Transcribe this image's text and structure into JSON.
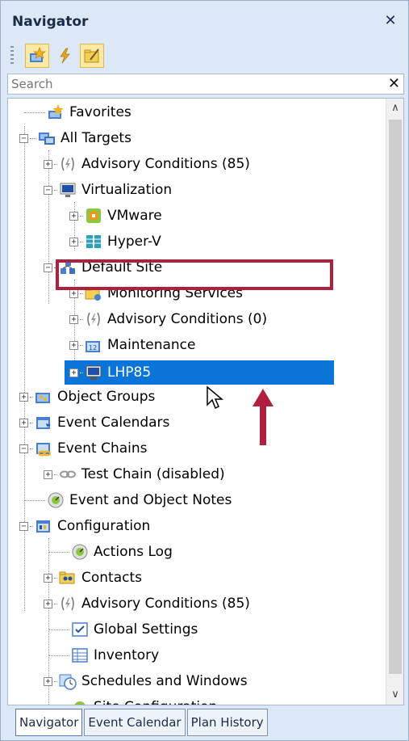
{
  "panel": {
    "title": "Navigator"
  },
  "search": {
    "placeholder": "Search"
  },
  "tree": [
    {
      "label": "Favorites"
    },
    {
      "label": "All Targets"
    },
    {
      "label": "Advisory Conditions (85)"
    },
    {
      "label": "Virtualization"
    },
    {
      "label": "VMware"
    },
    {
      "label": "Hyper-V"
    },
    {
      "label": "Default Site"
    },
    {
      "label": "Monitoring Services"
    },
    {
      "label": "Advisory Conditions (0)"
    },
    {
      "label": "Maintenance"
    },
    {
      "label": "LHP85",
      "selected": true
    },
    {
      "label": "Object Groups"
    },
    {
      "label": "Event Calendars"
    },
    {
      "label": "Event Chains"
    },
    {
      "label": "Test Chain (disabled)"
    },
    {
      "label": "Event and Object Notes"
    },
    {
      "label": "Configuration"
    },
    {
      "label": "Actions Log"
    },
    {
      "label": "Contacts"
    },
    {
      "label": "Advisory Conditions (85)"
    },
    {
      "label": "Global Settings"
    },
    {
      "label": "Inventory"
    },
    {
      "label": "Schedules and Windows"
    },
    {
      "label": "Site Configuration"
    }
  ],
  "tabs": [
    "Navigator",
    "Event Calendar",
    "Plan History"
  ],
  "colors": {
    "selection": "#0a74d8",
    "highlight_box": "#b0203e",
    "annotation_arrow": "#b0203e"
  }
}
